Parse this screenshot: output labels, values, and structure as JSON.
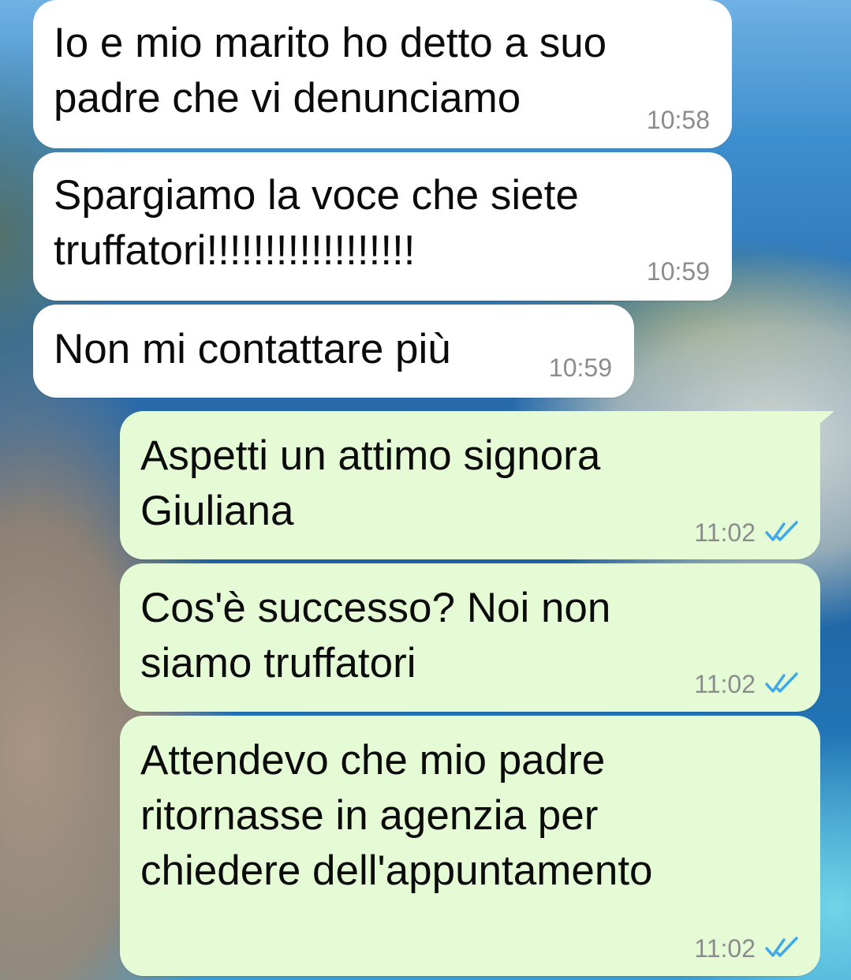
{
  "chat": {
    "messages": [
      {
        "direction": "incoming",
        "text": "Io e mio marito ho detto a suo\npadre che vi denunciamo",
        "time": "10:58"
      },
      {
        "direction": "incoming",
        "text": "Spargiamo la voce che siete\ntruffatori!!!!!!!!!!!!!!!!!!",
        "time": "10:59"
      },
      {
        "direction": "incoming",
        "text": "Non mi contattare più",
        "time": "10:59"
      },
      {
        "direction": "outgoing",
        "text": "Aspetti un attimo signora\nGiuliana",
        "time": "11:02",
        "status": "read",
        "status_icon": "double-check-icon"
      },
      {
        "direction": "outgoing",
        "text": "Cos'è successo? Noi non\nsiamo truffatori",
        "time": "11:02",
        "status": "read",
        "status_icon": "double-check-icon"
      },
      {
        "direction": "outgoing",
        "text": "Attendevo che mio padre\nritornasse in agenzia per\nchiedere dell'appuntamento",
        "time": "11:02",
        "status": "read",
        "status_icon": "double-check-icon"
      }
    ]
  },
  "colors": {
    "incoming_bubble": "#ffffff",
    "outgoing_bubble": "#e5fbd6",
    "read_ticks": "#3fa9e8",
    "timestamp": "#8c8c8c"
  }
}
